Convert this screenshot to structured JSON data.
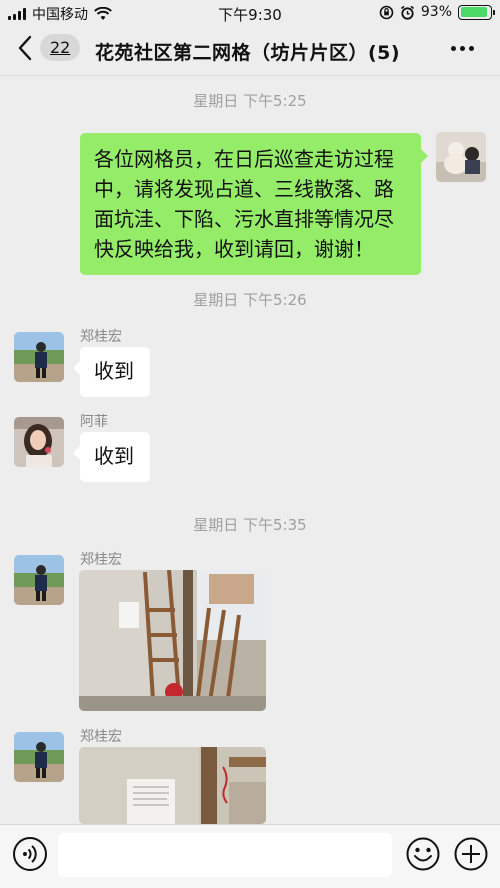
{
  "status_bar": {
    "carrier": "中国移动",
    "time": "下午9:30",
    "battery_text": "93%",
    "battery_level": 0.93
  },
  "nav": {
    "unread_count": "22",
    "title": "花苑社区第二网格（坊片片区）(5)"
  },
  "messages": [
    {
      "kind": "time",
      "text": "星期日 下午5:25"
    },
    {
      "kind": "text",
      "direction": "out",
      "text": "各位网格员，在日后巡查走访过程中，请将发现占道、三线散落、路面坑洼、下陷、污水直排等情况尽快反映给我，收到请回，谢谢！",
      "lines": [
        "各位网格员，在日后巡查走访过程",
        "中，请将发现占道、三线散落、路",
        "面坑洼、下陷、污水直排等情况尽",
        "快反映给我，收到请回，谢谢！"
      ]
    },
    {
      "kind": "time",
      "text": "星期日 下午5:26"
    },
    {
      "kind": "text",
      "direction": "in",
      "sender": "郑桂宏",
      "text": "收到"
    },
    {
      "kind": "text",
      "direction": "in",
      "sender": "阿菲",
      "text": "收到"
    },
    {
      "kind": "time",
      "text": "星期日 下午5:35"
    },
    {
      "kind": "image",
      "direction": "in",
      "sender": "郑桂宏"
    },
    {
      "kind": "image",
      "direction": "in",
      "sender": "郑桂宏"
    }
  ],
  "colors": {
    "outgoing_bubble": "#95ec69",
    "incoming_bubble": "#ffffff",
    "background": "#ededed",
    "battery": "#4cd964"
  },
  "icons": {
    "back": "chevron-left-icon",
    "more": "more-dots-icon",
    "voice": "voice-icon",
    "emoji": "emoji-icon",
    "plus": "plus-icon"
  }
}
